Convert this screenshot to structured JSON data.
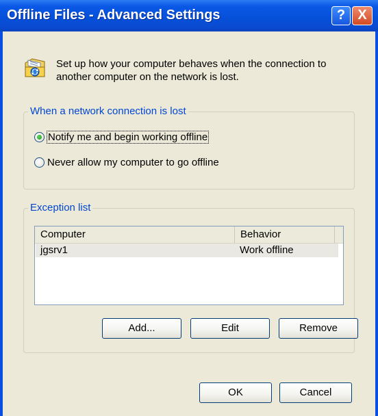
{
  "window": {
    "title": "Offline Files - Advanced Settings",
    "help_button": "?",
    "close_button": "X"
  },
  "info": {
    "icon": "offline-files-sync-icon",
    "text": "Set up how your computer behaves when the connection to another computer on the network is lost."
  },
  "network_group": {
    "label": "When a network connection is lost",
    "options": [
      {
        "label": "Notify me and begin working offline",
        "checked": true
      },
      {
        "label": "Never allow my computer to go offline",
        "checked": false
      }
    ]
  },
  "exception_group": {
    "label": "Exception list",
    "columns": [
      "Computer",
      "Behavior"
    ],
    "rows": [
      {
        "computer": "jgsrv1",
        "behavior": "Work offline"
      }
    ],
    "add_label": "Add...",
    "edit_label": "Edit",
    "remove_label": "Remove"
  },
  "footer": {
    "ok_label": "OK",
    "cancel_label": "Cancel"
  },
  "colors": {
    "titlebar": "#0a58e6",
    "dialog_bg": "#ece9d8",
    "group_label": "#0046d5",
    "close_button": "#d34a22"
  }
}
